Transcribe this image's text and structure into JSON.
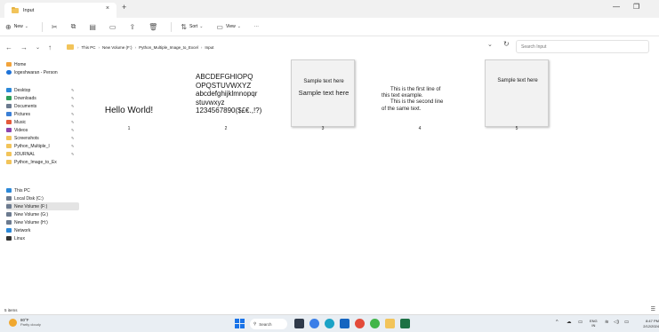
{
  "window": {
    "tab_title": "Input",
    "tab_close": "×",
    "new_tab": "+",
    "minimize": "—",
    "maximize": "❐"
  },
  "toolbar": {
    "new_label": "New",
    "sort_label": "Sort",
    "view_label": "View",
    "more": "···"
  },
  "address": {
    "crumbs": [
      "This PC",
      "New Volume (F:)",
      "Python_Multiple_Image_to_Excel",
      "Input"
    ],
    "search_placeholder": "Search Input"
  },
  "sidebar": {
    "items": [
      {
        "label": "Home",
        "color": "#f2a33a"
      },
      {
        "label": "logeshwaran - Person",
        "color": "#1e73d8"
      },
      {
        "label": "Desktop",
        "color": "#2b88d8"
      },
      {
        "label": "Downloads",
        "color": "#2e9e5b"
      },
      {
        "label": "Documents",
        "color": "#6b7a8f"
      },
      {
        "label": "Pictures",
        "color": "#3b7fd6"
      },
      {
        "label": "Music",
        "color": "#e45a3b"
      },
      {
        "label": "Videos",
        "color": "#8e44ad"
      },
      {
        "label": "Screenshots",
        "color": "#f2c45a"
      },
      {
        "label": "Python_Multiple_I",
        "color": "#f2c45a"
      },
      {
        "label": "JOURNAL",
        "color": "#f2c45a"
      },
      {
        "label": "Python_Image_to_Ex",
        "color": "#f2c45a"
      },
      {
        "label": "This PC",
        "color": "#2b88d8"
      },
      {
        "label": "Local Disk (C:)",
        "color": "#6b7a8f"
      },
      {
        "label": "New Volume (F:)",
        "color": "#6b7a8f"
      },
      {
        "label": "New Volume (G:)",
        "color": "#6b7a8f"
      },
      {
        "label": "New Volume (H:)",
        "color": "#6b7a8f"
      },
      {
        "label": "Network",
        "color": "#2b88d8"
      },
      {
        "label": "Linux",
        "color": "#333333"
      }
    ]
  },
  "files": [
    {
      "name": "1",
      "text": "Hello World!"
    },
    {
      "name": "2",
      "lines": [
        "ABCDEFGHIOPQ",
        "OPQSTUVWXYZ",
        "abcdefghijklmnopqr",
        "stuvwxyz",
        "1234567890($£€.,!?)"
      ]
    },
    {
      "name": "3",
      "line1": "Sample text here",
      "line2": "Sample text here"
    },
    {
      "name": "4",
      "lines": [
        "This is the first line of",
        "this text example.",
        "This is the second line",
        "of the same text."
      ]
    },
    {
      "name": "5",
      "text": "Sample text here"
    }
  ],
  "status": {
    "count": "5 items"
  },
  "taskbar": {
    "temp": "80°F",
    "weather": "Partly cloudy",
    "search": "Search",
    "lang1": "ENG",
    "lang2": "IN",
    "time": "8:47 PM",
    "date": "2/12/2024"
  }
}
